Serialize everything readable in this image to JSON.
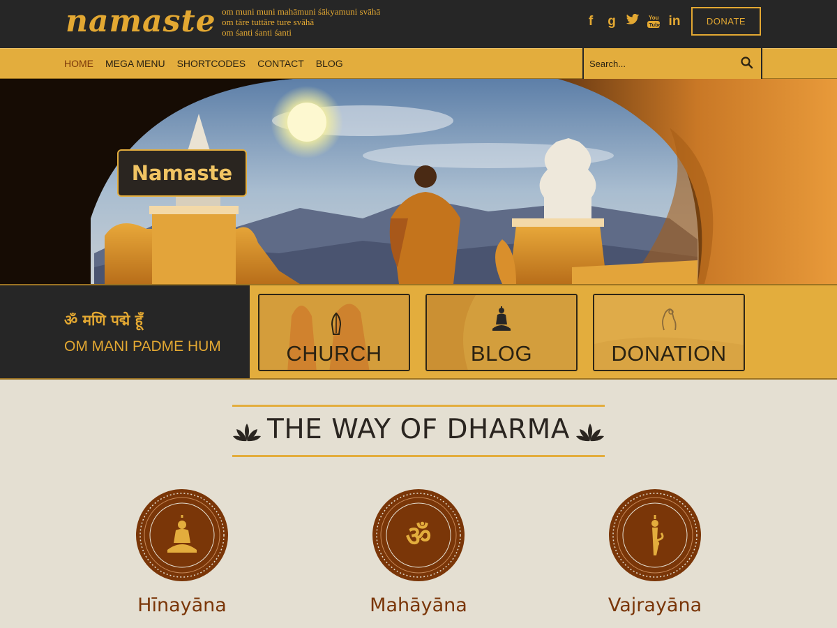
{
  "brand": {
    "logo": "namaste",
    "mantra_lines": [
      "om muni muni mahāmuni śākyamuni svāhā",
      "om tāre tuttāre ture svāhā",
      "om śanti śanti śanti"
    ]
  },
  "social": [
    "f",
    "g",
    "twitter",
    "YouTube",
    "in"
  ],
  "header": {
    "donate_label": "DONATE"
  },
  "nav": {
    "items": [
      "HOME",
      "MEGA MENU",
      "SHORTCODES",
      "CONTACT",
      "BLOG"
    ],
    "active": "HOME"
  },
  "search": {
    "placeholder": "Search..."
  },
  "hero": {
    "title": "Namaste"
  },
  "band": {
    "sanskrit": "ॐ मणि पद्मे हूँ",
    "mantra": "OM MANI PADME HUM",
    "cards": [
      "CHURCH",
      "BLOG",
      "DONATION"
    ]
  },
  "dharma": {
    "title": "THE WAY OF DHARMA",
    "columns": [
      "Hīnayāna",
      "Mahāyāna",
      "Vajrayāna"
    ]
  },
  "colors": {
    "accent": "#e3ad3d",
    "dark": "#262626",
    "maroon": "#7a3608",
    "background": "#e4dfd2"
  }
}
